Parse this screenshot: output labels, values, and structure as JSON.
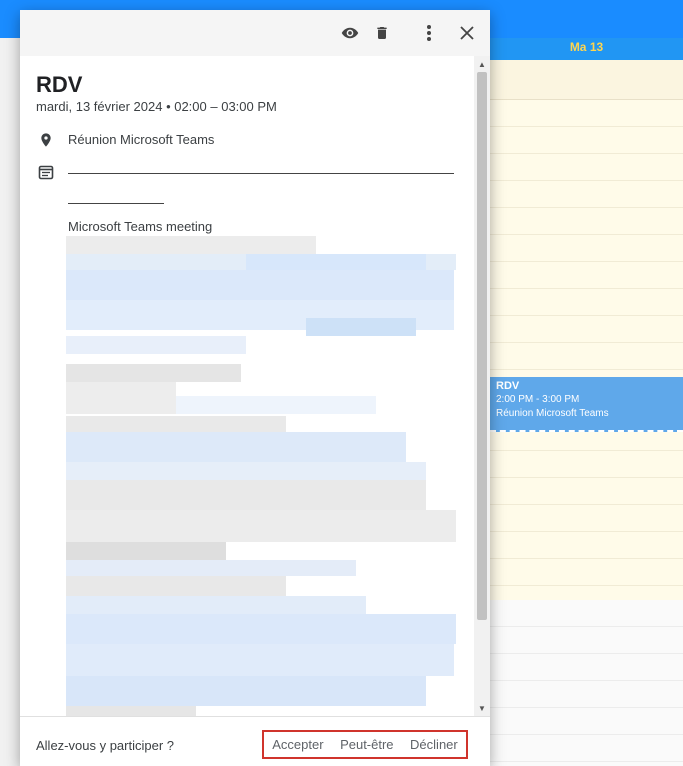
{
  "calendar": {
    "day_label": "Ma 13",
    "event": {
      "title": "RDV",
      "time": "2:00 PM - 3:00 PM",
      "location": "Réunion Microsoft Teams"
    }
  },
  "popup": {
    "title": "RDV",
    "date_line": "mardi, 13 février 2024 • 02:00 – 03:00 PM",
    "location": "Réunion Microsoft Teams",
    "description_heading": "Microsoft Teams meeting",
    "icons": [
      "eye-icon",
      "trash-icon",
      "more-vert-icon",
      "close-icon",
      "location-pin-icon",
      "description-icon"
    ],
    "footer": {
      "question": "Allez-vous y participer ?",
      "accept": "Accepter",
      "maybe": "Peut-être",
      "decline": "Décliner"
    }
  },
  "colors": {
    "accent_blue": "#2196f3",
    "event_blue": "#5fa8ea",
    "highlight_red": "#d0342c",
    "day_label_yellow": "#ffd54f"
  }
}
